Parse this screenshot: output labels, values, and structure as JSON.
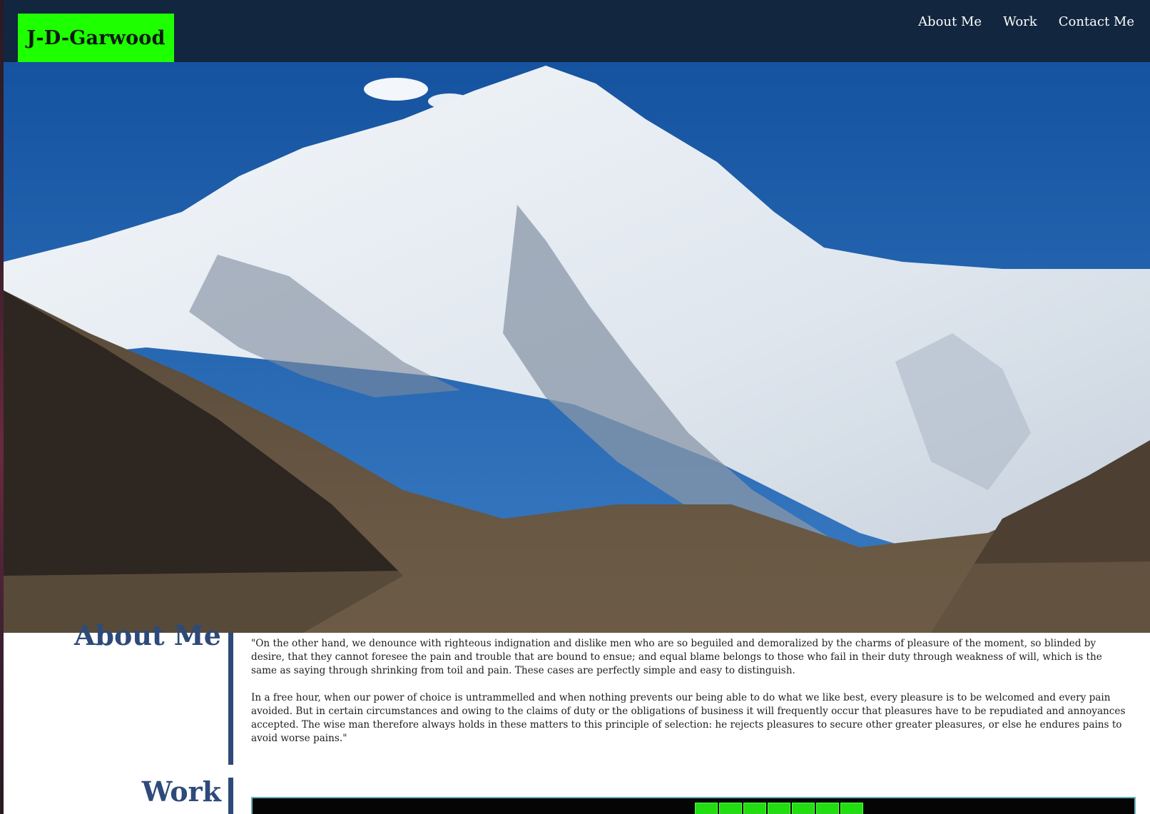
{
  "header": {
    "logo_text": "J-D-Garwood",
    "nav": [
      {
        "label": "About Me"
      },
      {
        "label": "Work"
      },
      {
        "label": "Contact Me"
      }
    ]
  },
  "hero": {
    "image": "snow-capped mountain peak under blue sky"
  },
  "about": {
    "title": "About Me",
    "paragraphs": [
      "\"On the other hand, we denounce with righteous indignation and dislike men who are so beguiled and demoralized by the charms of pleasure of the moment, so blinded by desire, that they cannot foresee the pain and trouble that are bound to ensue; and equal blame belongs to those who fail in their duty through weakness of will, which is the same as saying through shrinking from toil and pain. These cases are perfectly simple and easy to distinguish.",
      "In a free hour, when our power of choice is untrammelled and when nothing prevents our being able to do what we like best, every pleasure is to be welcomed and every pain avoided. But in certain circumstances and owing to the claims of duty or the obligations of business it will frequently occur that pleasures have to be repudiated and annoyances accepted. The wise man therefore always holds in these matters to this principle of selection: he rejects pleasures to secure other greater pleasures, or else he endures pains to avoid worse pains.\""
    ]
  },
  "work": {
    "title": "Work"
  },
  "colors": {
    "header_bg": "#12263f",
    "logo_bg": "#1eff00",
    "section_accent": "#2d4a7a"
  }
}
